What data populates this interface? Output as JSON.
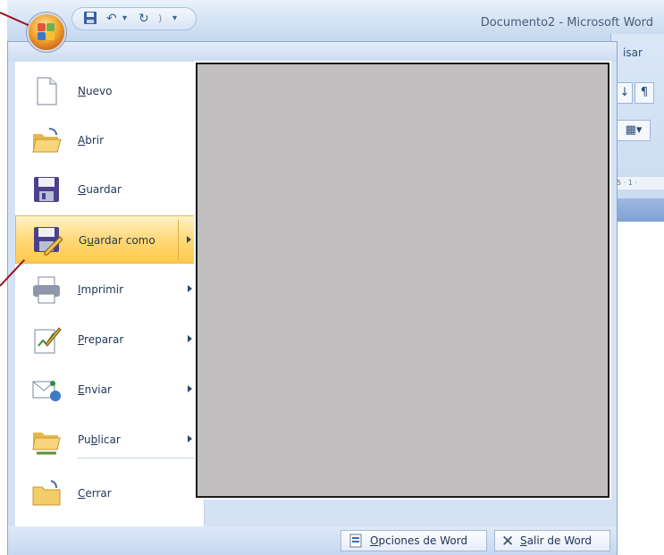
{
  "window": {
    "title": "Documento2 - Microsoft Word"
  },
  "quick_access_toolbar": {
    "icons": [
      "save-icon",
      "undo-icon",
      "redo-icon",
      "customize-icon"
    ]
  },
  "ribbon": {
    "partial_tab_label": "isar",
    "ruler_text": "5 · 1 ·"
  },
  "office_button": {
    "icon": "office-logo-icon"
  },
  "app_menu": {
    "commands": [
      {
        "pre": "",
        "acc": "N",
        "post": "uevo",
        "icon": "new-document-icon",
        "has_submenu": false
      },
      {
        "pre": "",
        "acc": "A",
        "post": "brir",
        "icon": "open-folder-icon",
        "has_submenu": false
      },
      {
        "pre": "",
        "acc": "G",
        "post": "uardar",
        "icon": "save-icon",
        "has_submenu": false
      },
      {
        "pre": "G",
        "acc": "u",
        "post": "ardar como",
        "icon": "save-as-icon",
        "has_submenu": true,
        "highlighted": true
      },
      {
        "pre": "",
        "acc": "I",
        "post": "mprimir",
        "icon": "printer-icon",
        "has_submenu": true
      },
      {
        "pre": "",
        "acc": "P",
        "post": "reparar",
        "icon": "prepare-icon",
        "has_submenu": true
      },
      {
        "pre": "",
        "acc": "E",
        "post": "nviar",
        "icon": "send-icon",
        "has_submenu": true
      },
      {
        "pre": "Pu",
        "acc": "b",
        "post": "licar",
        "icon": "publish-icon",
        "has_submenu": true
      },
      {
        "pre": "",
        "acc": "C",
        "post": "errar",
        "icon": "close-folder-icon",
        "has_submenu": false
      }
    ],
    "footer": {
      "options": {
        "pre": "",
        "acc": "O",
        "post": "pciones de Word",
        "icon": "options-icon"
      },
      "exit": {
        "pre": "",
        "acc": "S",
        "post": "alir de Word",
        "icon": "exit-icon"
      }
    }
  },
  "colors": {
    "highlight": "#ffd978",
    "callout": "#9b0e1f",
    "preview_panel": "#c1bfc0"
  }
}
